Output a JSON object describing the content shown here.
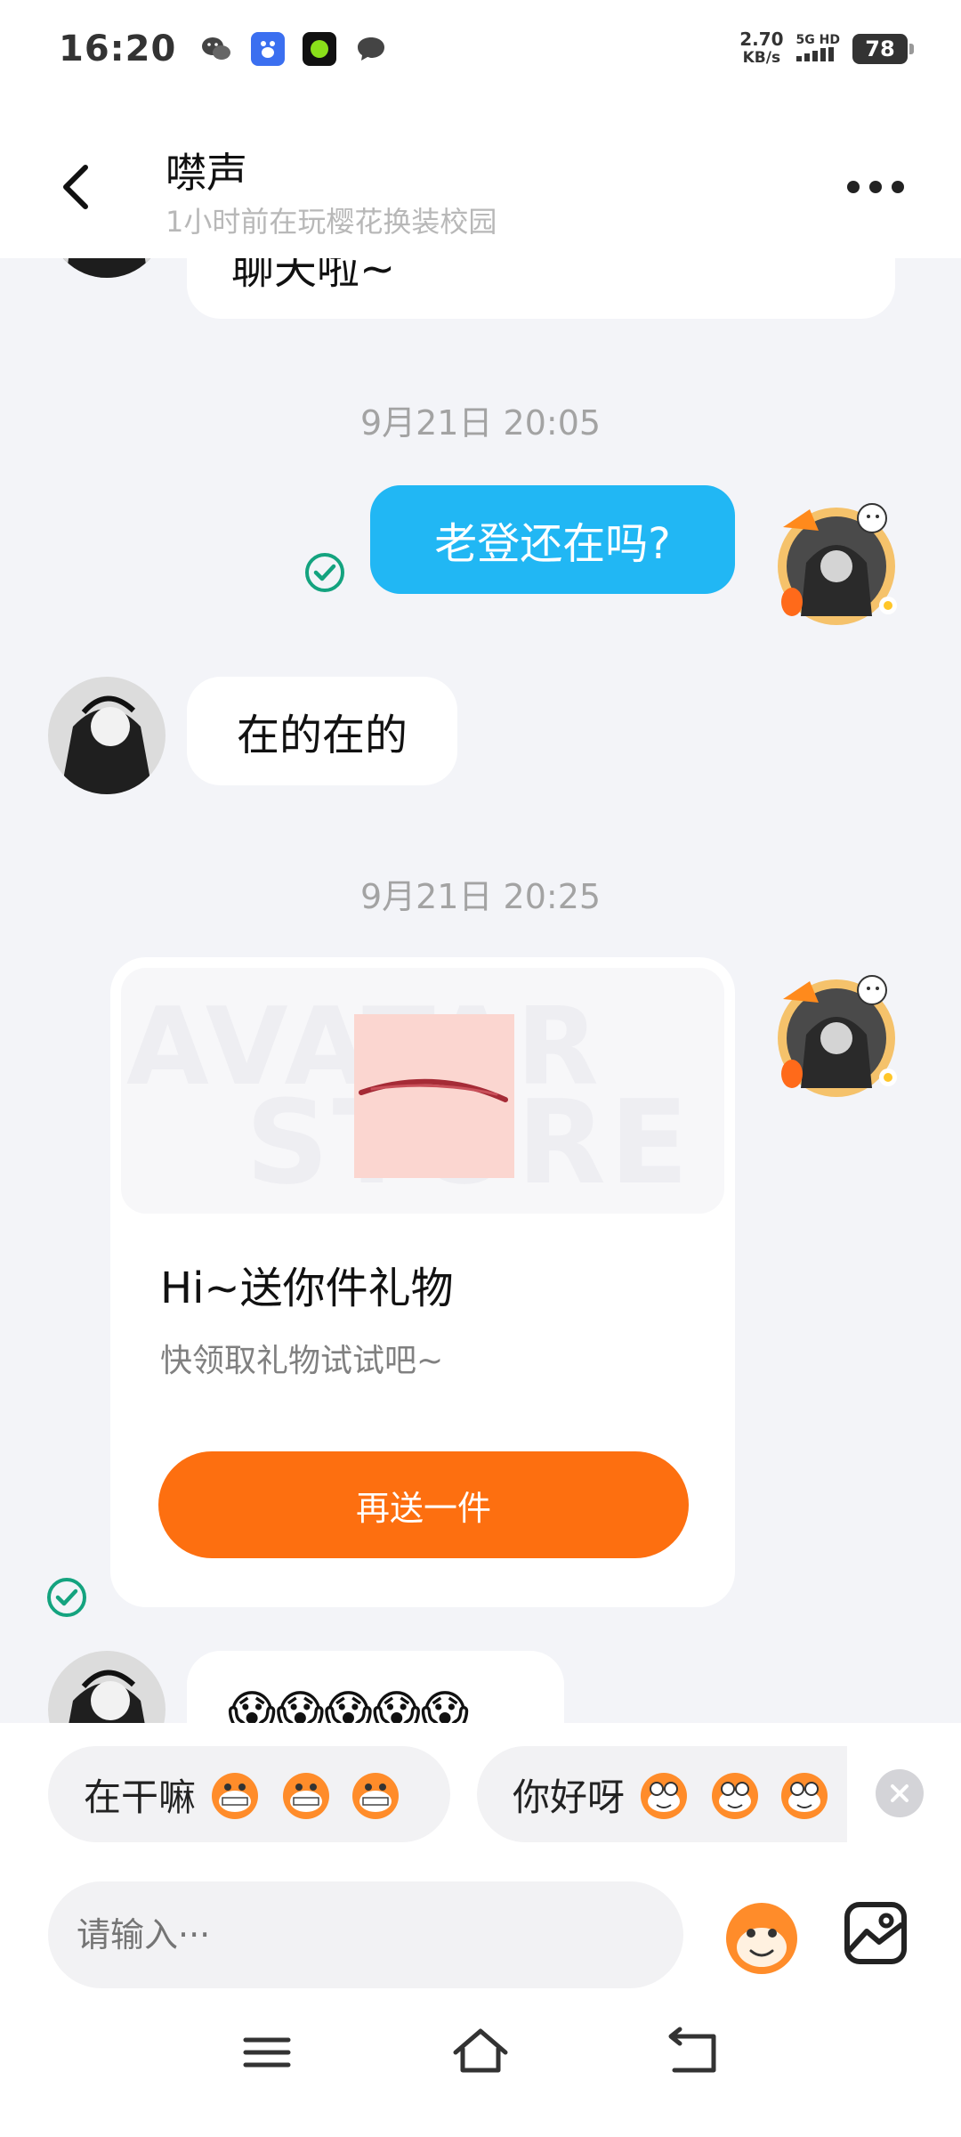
{
  "status_bar": {
    "time": "16:20",
    "speed_value": "2.70",
    "speed_unit": "KB/s",
    "network": "5G HD",
    "battery": "78",
    "app_icons": [
      "wechat-icon",
      "baidu-icon",
      "green-app-icon",
      "message-icon"
    ]
  },
  "header": {
    "title": "噤声",
    "subtitle": "1小时前在玩樱花换装校园"
  },
  "chat": {
    "partial_message": "聊天啦~",
    "timestamp_1": "9月21日 20:05",
    "outgoing_message": "老登还在吗?",
    "incoming_message": "在的在的",
    "timestamp_2": "9月21日 20:25",
    "gift_card": {
      "title": "Hi~送你件礼物",
      "description": "快领取礼物试试吧~",
      "button_label": "再送一件",
      "watermark_1": "AVATAR",
      "watermark_2": "STORE"
    },
    "emoji_message": "😱😱😱😱😱"
  },
  "quick_replies": [
    {
      "label": "在干嘛"
    },
    {
      "label": "你好呀"
    }
  ],
  "input": {
    "placeholder": "请输入···"
  },
  "colors": {
    "outgoing_bubble": "#21b7f4",
    "gift_button": "#fd6f10",
    "check_green": "#14a37f"
  }
}
